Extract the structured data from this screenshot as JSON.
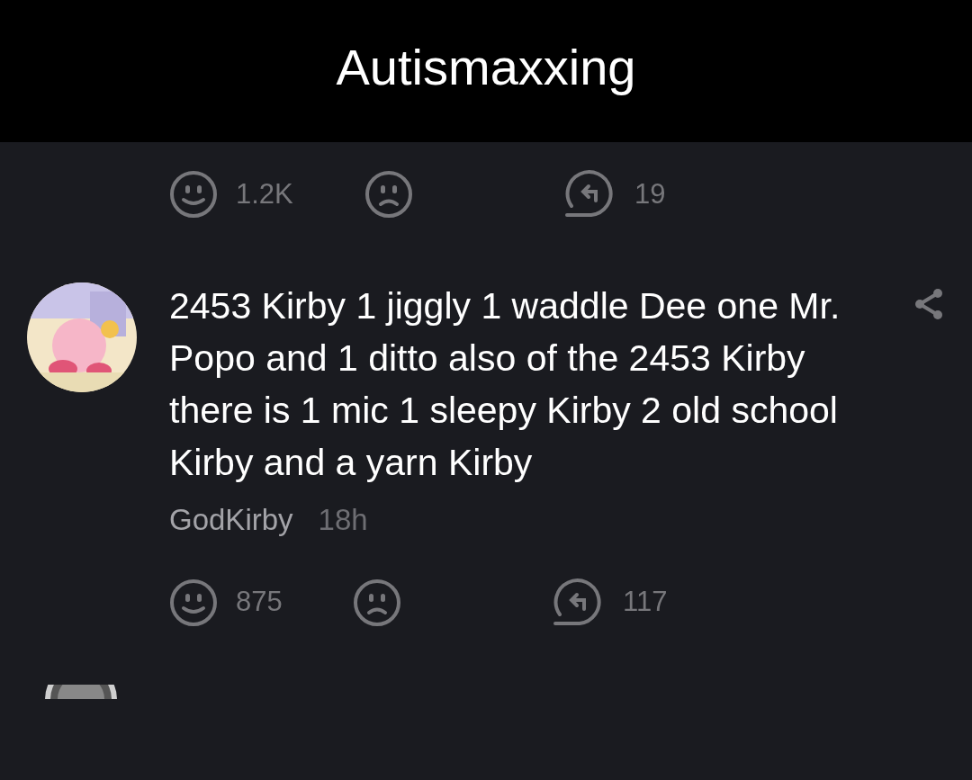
{
  "header": {
    "title": "Autismaxxing"
  },
  "post_actions": {
    "likes": "1.2K",
    "replies": "19"
  },
  "comment": {
    "text": "2453 Kirby 1 jiggly 1 waddle Dee one Mr. Popo and 1 ditto also of the 2453 Kirby there is 1 mic 1 sleepy Kirby 2 old school Kirby and a yarn Kirby",
    "author": "GodKirby",
    "time": "18h",
    "likes": "875",
    "replies": "117"
  }
}
